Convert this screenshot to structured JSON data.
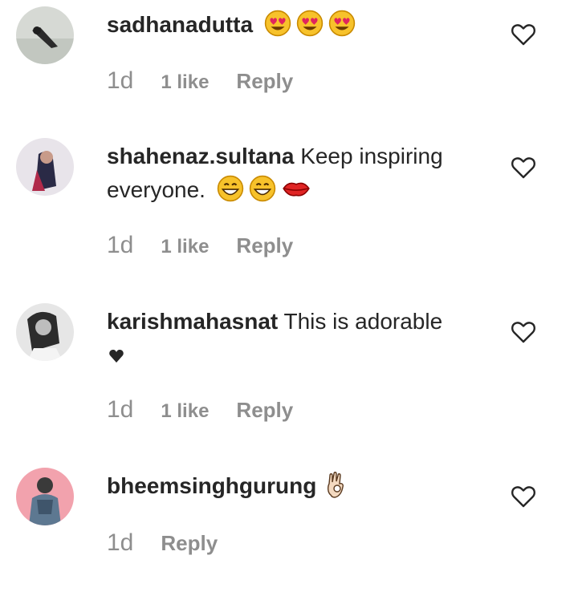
{
  "comments": [
    {
      "username": "sadhanadutta",
      "text": "",
      "emojis": [
        "heart-eyes",
        "heart-eyes",
        "heart-eyes"
      ],
      "time": "1d",
      "likes": "1 like",
      "reply": "Reply",
      "like_icon": "heart-outline-icon"
    },
    {
      "username": "shahenaz.sultana",
      "text": "Keep inspiring everyone.",
      "emojis": [
        "grinning",
        "grinning",
        "lips"
      ],
      "time": "1d",
      "likes": "1 like",
      "reply": "Reply",
      "like_icon": "heart-outline-icon"
    },
    {
      "username": "karishmahasnat",
      "text": "This is adorable",
      "emojis": [
        "black-heart"
      ],
      "time": "1d",
      "likes": "1 like",
      "reply": "Reply",
      "like_icon": "heart-outline-icon"
    },
    {
      "username": "bheemsinghgurung",
      "text": "",
      "emojis": [
        "ok-hand"
      ],
      "time": "1d",
      "likes": "",
      "reply": "Reply",
      "like_icon": "heart-outline-icon"
    }
  ],
  "colors": {
    "text": "#262626",
    "muted": "#8e8e8e",
    "emoji_yellow": "#f7c22b",
    "emoji_red": "#e0245e"
  }
}
